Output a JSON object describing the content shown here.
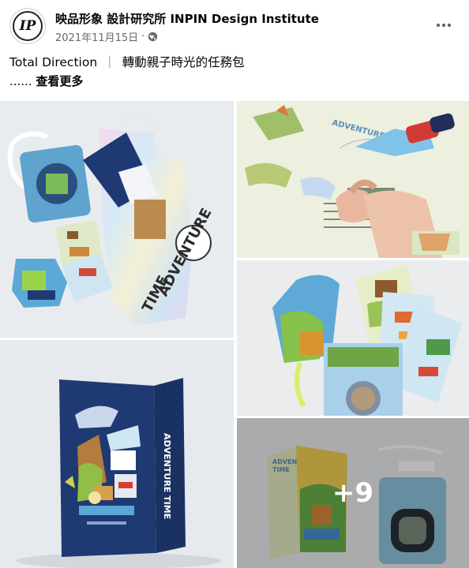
{
  "post": {
    "page_name": "映品形象 設計研究所 INPIN Design Institute",
    "avatar_text": "IP",
    "date": "2021年11月15日",
    "dot": "·",
    "caption_left": "Total Direction",
    "caption_sep": "｜",
    "caption_right": "轉動親子時光的任務包",
    "ellipsis": "......",
    "see_more": "查看更多"
  },
  "photos": {
    "adventure_label": "ADVENTURE TIME",
    "adventure_word1": "ADVENTURE",
    "adventure_word2": "TIME",
    "more_count": "+9"
  },
  "colors": {
    "navy": "#1f3a72",
    "sky": "#7fb6d9",
    "yellow_green": "#c9e34a",
    "meta_gray": "#65676b"
  },
  "icons": {
    "visibility": "globe-icon",
    "menu": "more-horizontal-icon"
  }
}
